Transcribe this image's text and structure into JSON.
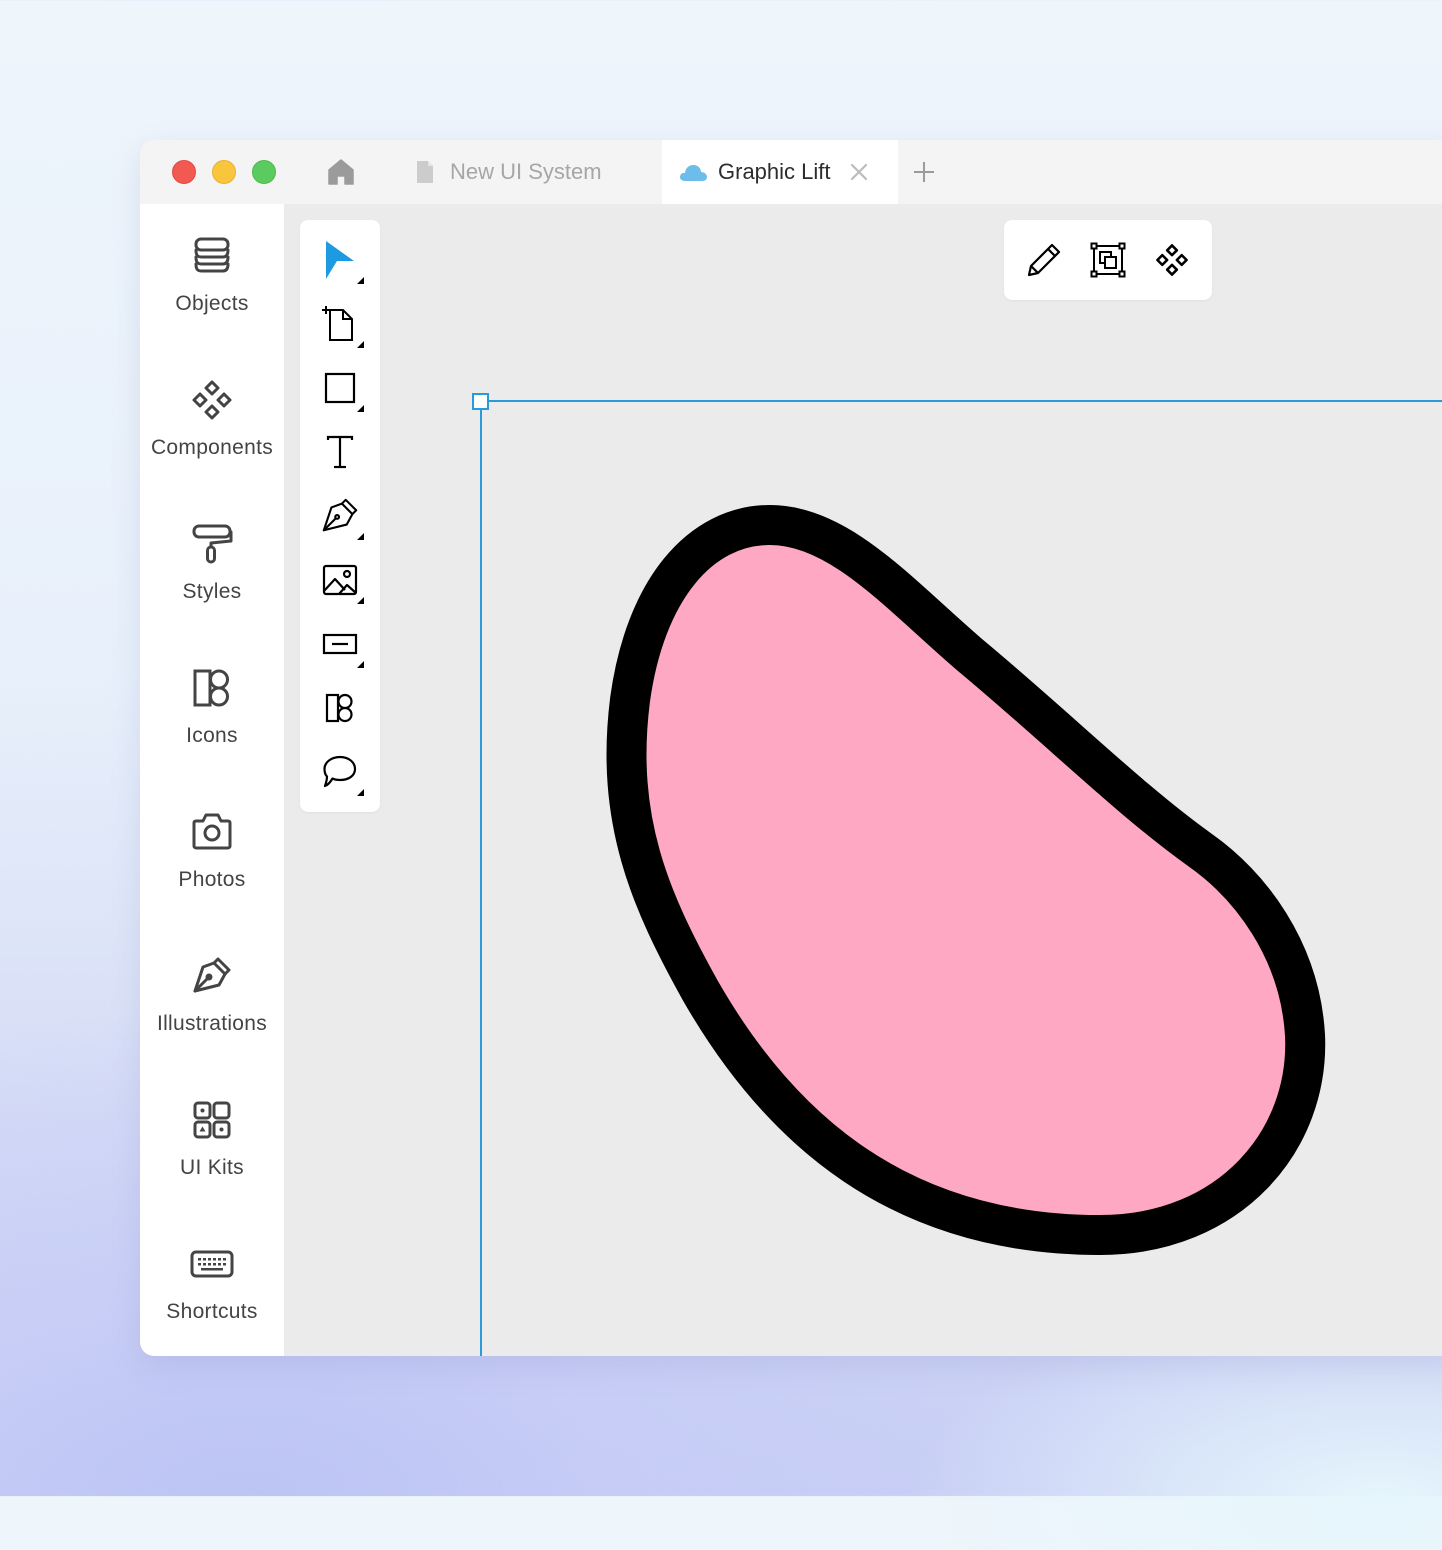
{
  "window": {
    "traffic_lights": [
      {
        "name": "close",
        "color": "#f25a51"
      },
      {
        "name": "minimize",
        "color": "#f8c53c"
      },
      {
        "name": "maximize",
        "color": "#5ccb5f"
      }
    ],
    "home_icon": "home-icon",
    "tabs": [
      {
        "label": "New UI System",
        "icon": "document-icon",
        "active": false
      },
      {
        "label": "Graphic Lift",
        "icon": "cloud-icon",
        "active": true,
        "icon_color": "#6cbde9"
      }
    ],
    "tab_close_icon": "close-icon",
    "new_tab_icon": "plus-icon"
  },
  "sidebar": {
    "items": [
      {
        "label": "Objects",
        "icon": "layers-icon"
      },
      {
        "label": "Components",
        "icon": "components-icon"
      },
      {
        "label": "Styles",
        "icon": "paint-roller-icon"
      },
      {
        "label": "Icons",
        "icon": "icons-icon"
      },
      {
        "label": "Photos",
        "icon": "camera-icon"
      },
      {
        "label": "Illustrations",
        "icon": "pen-nib-icon"
      },
      {
        "label": "UI Kits",
        "icon": "ui-kits-icon"
      },
      {
        "label": "Shortcuts",
        "icon": "keyboard-icon"
      }
    ]
  },
  "toolbox": {
    "tools": [
      {
        "name": "select",
        "icon": "cursor-arrow-icon",
        "active": true,
        "has_submenu": true
      },
      {
        "name": "artboard",
        "icon": "artboard-icon",
        "has_submenu": true
      },
      {
        "name": "rectangle",
        "icon": "rectangle-icon",
        "has_submenu": true
      },
      {
        "name": "text",
        "icon": "text-icon",
        "has_submenu": false
      },
      {
        "name": "pen",
        "icon": "pen-nib-icon",
        "has_submenu": true
      },
      {
        "name": "image",
        "icon": "image-icon",
        "has_submenu": true
      },
      {
        "name": "input",
        "icon": "input-field-icon",
        "has_submenu": true
      },
      {
        "name": "icons",
        "icon": "icons-icon",
        "has_submenu": false
      },
      {
        "name": "comment",
        "icon": "speech-bubble-icon",
        "has_submenu": true
      }
    ],
    "accent_color": "#1e9be0"
  },
  "floating_toolbar": {
    "buttons": [
      {
        "name": "edit",
        "icon": "pencil-icon"
      },
      {
        "name": "group-selection",
        "icon": "group-bounds-icon"
      },
      {
        "name": "create-component",
        "icon": "components-icon"
      }
    ]
  },
  "canvas": {
    "background": "#ebebeb",
    "artboard_guide_color": "#2b9ad8",
    "shape": {
      "type": "blob",
      "fill": "#ffa8c3",
      "stroke": "#000000"
    }
  }
}
